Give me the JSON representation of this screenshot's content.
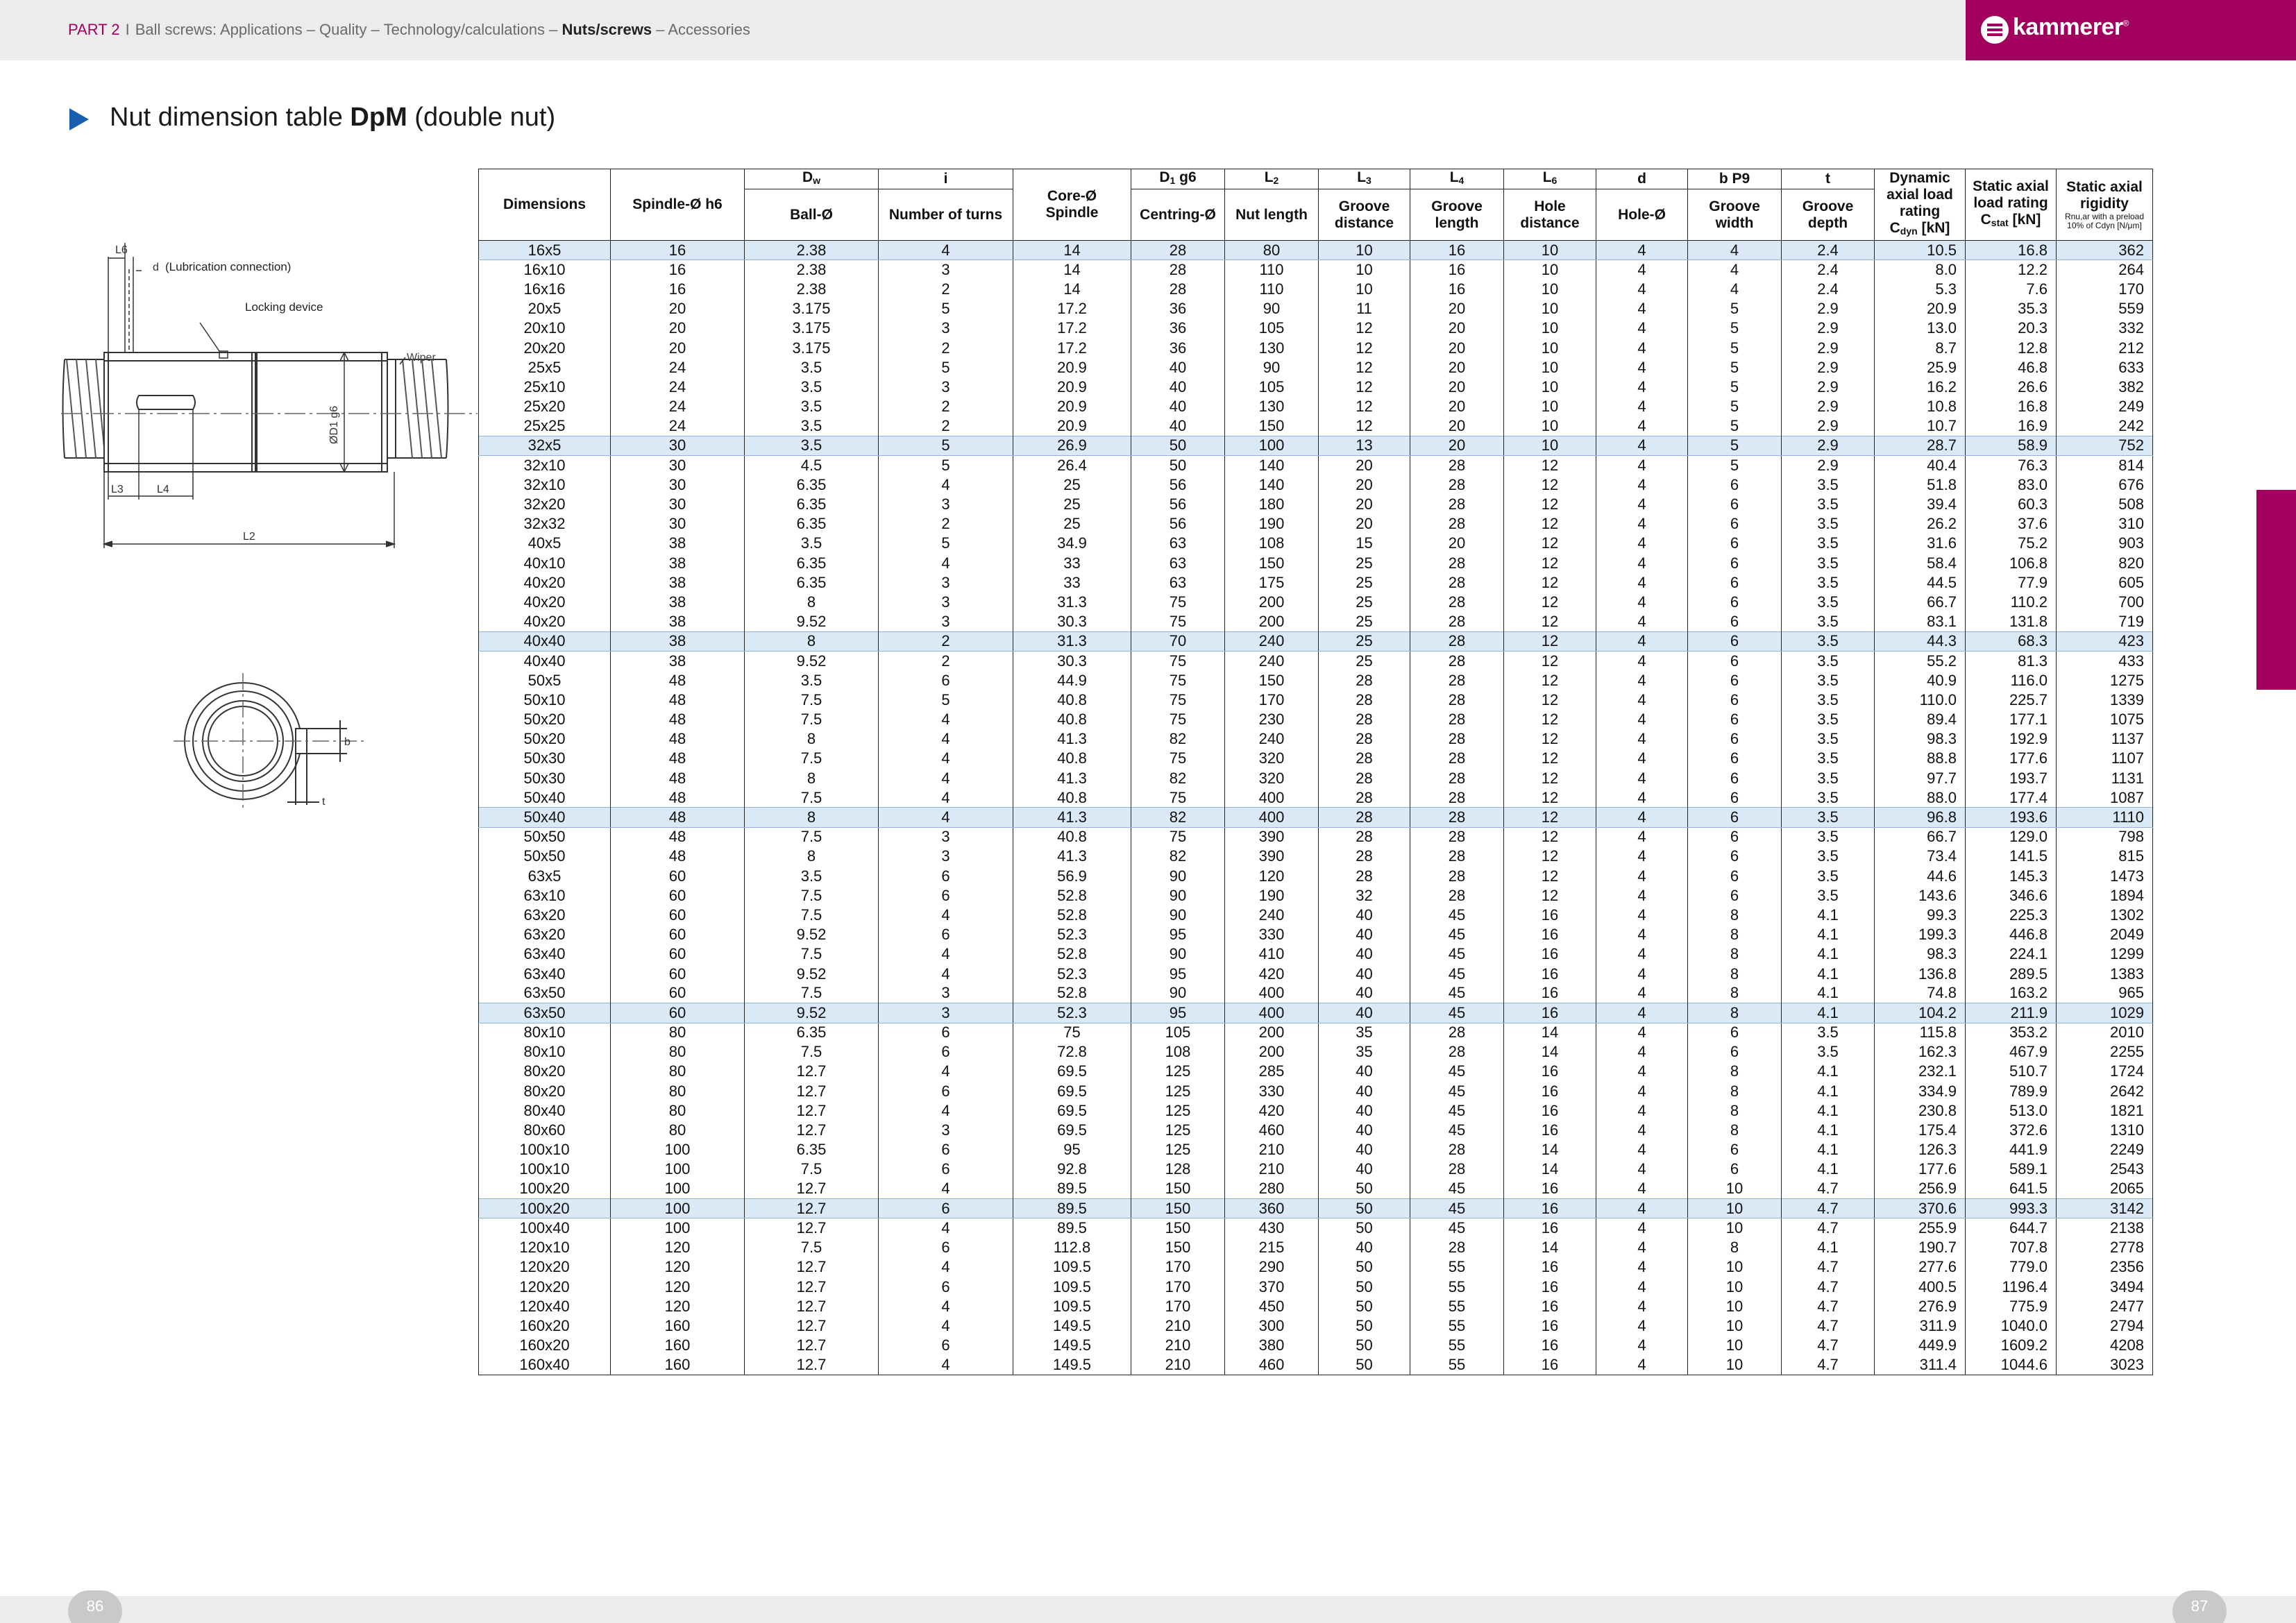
{
  "header": {
    "part": "PART 2",
    "separator": "I",
    "crumbs_before": "Ball screws: Applications – Quality – Technology/calculations –",
    "current": "Nuts/screws",
    "crumbs_after": "– Accessories"
  },
  "brand": {
    "name": "kammerer",
    "reg": "®",
    "color": "#a1005f"
  },
  "title": {
    "prefix": "Nut dimension table",
    "bold": "DpM",
    "suffix": "(double nut)"
  },
  "drawing_labels": {
    "l6": "L6",
    "d": "d",
    "lubrication": "(Lubrication connection)",
    "locking": "Locking device",
    "wiper": "Wiper",
    "d1g6": "ØD1 g6",
    "l3": "L3",
    "l4": "L4",
    "l2": "L2",
    "b": "b",
    "t": "t"
  },
  "table": {
    "header_row1": {
      "dw": "D",
      "dw_sub": "w",
      "i": "i",
      "d1": "D",
      "d1_sub": "1",
      "d1_suffix": " g6",
      "l2": "L",
      "l2_sub": "2",
      "l3": "L",
      "l3_sub": "3",
      "l4": "L",
      "l4_sub": "4",
      "l6": "L",
      "l6_sub": "6",
      "d": "d",
      "bp9": "b P9",
      "t": "t"
    },
    "header_row2": {
      "dimensions": "Dimensions",
      "spindle": "Spindle-Ø h6",
      "ball": "Ball-Ø",
      "turns": "Number of turns",
      "core_1": "Core-Ø",
      "core_2": "Spindle",
      "centring": "Centring-Ø",
      "nut_length": "Nut length",
      "groove_distance_1": "Groove",
      "groove_distance_2": "distance",
      "groove_length_1": "Groove",
      "groove_length_2": "length",
      "hole_distance_1": "Hole",
      "hole_distance_2": "distance",
      "hole": "Hole-Ø",
      "groove_width_1": "Groove",
      "groove_width_2": "width",
      "groove_depth_1": "Groove",
      "groove_depth_2": "depth",
      "dyn_1": "Dynamic",
      "dyn_2": "axial load",
      "dyn_3": "rating",
      "dyn_4": "C",
      "dyn_4_sub": "dyn",
      "dyn_4_unit": " [kN]",
      "stat_1": "Static axial",
      "stat_2": "load rating",
      "stat_3": "C",
      "stat_3_sub": "stat",
      "stat_3_unit": " [kN]",
      "rig_1": "Static axial",
      "rig_2": "rigidity",
      "rig_3": "R",
      "rig_3_sub": "nu,ar",
      "rig_3_rest": " with a preload",
      "rig_4": "10% of C",
      "rig_4_sub": "dyn",
      "rig_4_rest": " [N/μm]"
    },
    "rows": [
      [
        "16x5",
        "16",
        "2.38",
        "4",
        "14",
        "28",
        "80",
        "10",
        "16",
        "10",
        "4",
        "4",
        "2.4",
        "10.5",
        "16.8",
        "362"
      ],
      [
        "16x10",
        "16",
        "2.38",
        "3",
        "14",
        "28",
        "110",
        "10",
        "16",
        "10",
        "4",
        "4",
        "2.4",
        "8.0",
        "12.2",
        "264"
      ],
      [
        "16x16",
        "16",
        "2.38",
        "2",
        "14",
        "28",
        "110",
        "10",
        "16",
        "10",
        "4",
        "4",
        "2.4",
        "5.3",
        "7.6",
        "170"
      ],
      [
        "20x5",
        "20",
        "3.175",
        "5",
        "17.2",
        "36",
        "90",
        "11",
        "20",
        "10",
        "4",
        "5",
        "2.9",
        "20.9",
        "35.3",
        "559"
      ],
      [
        "20x10",
        "20",
        "3.175",
        "3",
        "17.2",
        "36",
        "105",
        "12",
        "20",
        "10",
        "4",
        "5",
        "2.9",
        "13.0",
        "20.3",
        "332"
      ],
      [
        "20x20",
        "20",
        "3.175",
        "2",
        "17.2",
        "36",
        "130",
        "12",
        "20",
        "10",
        "4",
        "5",
        "2.9",
        "8.7",
        "12.8",
        "212"
      ],
      [
        "25x5",
        "24",
        "3.5",
        "5",
        "20.9",
        "40",
        "90",
        "12",
        "20",
        "10",
        "4",
        "5",
        "2.9",
        "25.9",
        "46.8",
        "633"
      ],
      [
        "25x10",
        "24",
        "3.5",
        "3",
        "20.9",
        "40",
        "105",
        "12",
        "20",
        "10",
        "4",
        "5",
        "2.9",
        "16.2",
        "26.6",
        "382"
      ],
      [
        "25x20",
        "24",
        "3.5",
        "2",
        "20.9",
        "40",
        "130",
        "12",
        "20",
        "10",
        "4",
        "5",
        "2.9",
        "10.8",
        "16.8",
        "249"
      ],
      [
        "25x25",
        "24",
        "3.5",
        "2",
        "20.9",
        "40",
        "150",
        "12",
        "20",
        "10",
        "4",
        "5",
        "2.9",
        "10.7",
        "16.9",
        "242"
      ],
      [
        "32x5",
        "30",
        "3.5",
        "5",
        "26.9",
        "50",
        "100",
        "13",
        "20",
        "10",
        "4",
        "5",
        "2.9",
        "28.7",
        "58.9",
        "752"
      ],
      [
        "32x10",
        "30",
        "4.5",
        "5",
        "26.4",
        "50",
        "140",
        "20",
        "28",
        "12",
        "4",
        "5",
        "2.9",
        "40.4",
        "76.3",
        "814"
      ],
      [
        "32x10",
        "30",
        "6.35",
        "4",
        "25",
        "56",
        "140",
        "20",
        "28",
        "12",
        "4",
        "6",
        "3.5",
        "51.8",
        "83.0",
        "676"
      ],
      [
        "32x20",
        "30",
        "6.35",
        "3",
        "25",
        "56",
        "180",
        "20",
        "28",
        "12",
        "4",
        "6",
        "3.5",
        "39.4",
        "60.3",
        "508"
      ],
      [
        "32x32",
        "30",
        "6.35",
        "2",
        "25",
        "56",
        "190",
        "20",
        "28",
        "12",
        "4",
        "6",
        "3.5",
        "26.2",
        "37.6",
        "310"
      ],
      [
        "40x5",
        "38",
        "3.5",
        "5",
        "34.9",
        "63",
        "108",
        "15",
        "20",
        "12",
        "4",
        "6",
        "3.5",
        "31.6",
        "75.2",
        "903"
      ],
      [
        "40x10",
        "38",
        "6.35",
        "4",
        "33",
        "63",
        "150",
        "25",
        "28",
        "12",
        "4",
        "6",
        "3.5",
        "58.4",
        "106.8",
        "820"
      ],
      [
        "40x20",
        "38",
        "6.35",
        "3",
        "33",
        "63",
        "175",
        "25",
        "28",
        "12",
        "4",
        "6",
        "3.5",
        "44.5",
        "77.9",
        "605"
      ],
      [
        "40x20",
        "38",
        "8",
        "3",
        "31.3",
        "75",
        "200",
        "25",
        "28",
        "12",
        "4",
        "6",
        "3.5",
        "66.7",
        "110.2",
        "700"
      ],
      [
        "40x20",
        "38",
        "9.52",
        "3",
        "30.3",
        "75",
        "200",
        "25",
        "28",
        "12",
        "4",
        "6",
        "3.5",
        "83.1",
        "131.8",
        "719"
      ],
      [
        "40x40",
        "38",
        "8",
        "2",
        "31.3",
        "70",
        "240",
        "25",
        "28",
        "12",
        "4",
        "6",
        "3.5",
        "44.3",
        "68.3",
        "423"
      ],
      [
        "40x40",
        "38",
        "9.52",
        "2",
        "30.3",
        "75",
        "240",
        "25",
        "28",
        "12",
        "4",
        "6",
        "3.5",
        "55.2",
        "81.3",
        "433"
      ],
      [
        "50x5",
        "48",
        "3.5",
        "6",
        "44.9",
        "75",
        "150",
        "28",
        "28",
        "12",
        "4",
        "6",
        "3.5",
        "40.9",
        "116.0",
        "1275"
      ],
      [
        "50x10",
        "48",
        "7.5",
        "5",
        "40.8",
        "75",
        "170",
        "28",
        "28",
        "12",
        "4",
        "6",
        "3.5",
        "110.0",
        "225.7",
        "1339"
      ],
      [
        "50x20",
        "48",
        "7.5",
        "4",
        "40.8",
        "75",
        "230",
        "28",
        "28",
        "12",
        "4",
        "6",
        "3.5",
        "89.4",
        "177.1",
        "1075"
      ],
      [
        "50x20",
        "48",
        "8",
        "4",
        "41.3",
        "82",
        "240",
        "28",
        "28",
        "12",
        "4",
        "6",
        "3.5",
        "98.3",
        "192.9",
        "1137"
      ],
      [
        "50x30",
        "48",
        "7.5",
        "4",
        "40.8",
        "75",
        "320",
        "28",
        "28",
        "12",
        "4",
        "6",
        "3.5",
        "88.8",
        "177.6",
        "1107"
      ],
      [
        "50x30",
        "48",
        "8",
        "4",
        "41.3",
        "82",
        "320",
        "28",
        "28",
        "12",
        "4",
        "6",
        "3.5",
        "97.7",
        "193.7",
        "1131"
      ],
      [
        "50x40",
        "48",
        "7.5",
        "4",
        "40.8",
        "75",
        "400",
        "28",
        "28",
        "12",
        "4",
        "6",
        "3.5",
        "88.0",
        "177.4",
        "1087"
      ],
      [
        "50x40",
        "48",
        "8",
        "4",
        "41.3",
        "82",
        "400",
        "28",
        "28",
        "12",
        "4",
        "6",
        "3.5",
        "96.8",
        "193.6",
        "1110"
      ],
      [
        "50x50",
        "48",
        "7.5",
        "3",
        "40.8",
        "75",
        "390",
        "28",
        "28",
        "12",
        "4",
        "6",
        "3.5",
        "66.7",
        "129.0",
        "798"
      ],
      [
        "50x50",
        "48",
        "8",
        "3",
        "41.3",
        "82",
        "390",
        "28",
        "28",
        "12",
        "4",
        "6",
        "3.5",
        "73.4",
        "141.5",
        "815"
      ],
      [
        "63x5",
        "60",
        "3.5",
        "6",
        "56.9",
        "90",
        "120",
        "28",
        "28",
        "12",
        "4",
        "6",
        "3.5",
        "44.6",
        "145.3",
        "1473"
      ],
      [
        "63x10",
        "60",
        "7.5",
        "6",
        "52.8",
        "90",
        "190",
        "32",
        "28",
        "12",
        "4",
        "6",
        "3.5",
        "143.6",
        "346.6",
        "1894"
      ],
      [
        "63x20",
        "60",
        "7.5",
        "4",
        "52.8",
        "90",
        "240",
        "40",
        "45",
        "16",
        "4",
        "8",
        "4.1",
        "99.3",
        "225.3",
        "1302"
      ],
      [
        "63x20",
        "60",
        "9.52",
        "6",
        "52.3",
        "95",
        "330",
        "40",
        "45",
        "16",
        "4",
        "8",
        "4.1",
        "199.3",
        "446.8",
        "2049"
      ],
      [
        "63x40",
        "60",
        "7.5",
        "4",
        "52.8",
        "90",
        "410",
        "40",
        "45",
        "16",
        "4",
        "8",
        "4.1",
        "98.3",
        "224.1",
        "1299"
      ],
      [
        "63x40",
        "60",
        "9.52",
        "4",
        "52.3",
        "95",
        "420",
        "40",
        "45",
        "16",
        "4",
        "8",
        "4.1",
        "136.8",
        "289.5",
        "1383"
      ],
      [
        "63x50",
        "60",
        "7.5",
        "3",
        "52.8",
        "90",
        "400",
        "40",
        "45",
        "16",
        "4",
        "8",
        "4.1",
        "74.8",
        "163.2",
        "965"
      ],
      [
        "63x50",
        "60",
        "9.52",
        "3",
        "52.3",
        "95",
        "400",
        "40",
        "45",
        "16",
        "4",
        "8",
        "4.1",
        "104.2",
        "211.9",
        "1029"
      ],
      [
        "80x10",
        "80",
        "6.35",
        "6",
        "75",
        "105",
        "200",
        "35",
        "28",
        "14",
        "4",
        "6",
        "3.5",
        "115.8",
        "353.2",
        "2010"
      ],
      [
        "80x10",
        "80",
        "7.5",
        "6",
        "72.8",
        "108",
        "200",
        "35",
        "28",
        "14",
        "4",
        "6",
        "3.5",
        "162.3",
        "467.9",
        "2255"
      ],
      [
        "80x20",
        "80",
        "12.7",
        "4",
        "69.5",
        "125",
        "285",
        "40",
        "45",
        "16",
        "4",
        "8",
        "4.1",
        "232.1",
        "510.7",
        "1724"
      ],
      [
        "80x20",
        "80",
        "12.7",
        "6",
        "69.5",
        "125",
        "330",
        "40",
        "45",
        "16",
        "4",
        "8",
        "4.1",
        "334.9",
        "789.9",
        "2642"
      ],
      [
        "80x40",
        "80",
        "12.7",
        "4",
        "69.5",
        "125",
        "420",
        "40",
        "45",
        "16",
        "4",
        "8",
        "4.1",
        "230.8",
        "513.0",
        "1821"
      ],
      [
        "80x60",
        "80",
        "12.7",
        "3",
        "69.5",
        "125",
        "460",
        "40",
        "45",
        "16",
        "4",
        "8",
        "4.1",
        "175.4",
        "372.6",
        "1310"
      ],
      [
        "100x10",
        "100",
        "6.35",
        "6",
        "95",
        "125",
        "210",
        "40",
        "28",
        "14",
        "4",
        "6",
        "4.1",
        "126.3",
        "441.9",
        "2249"
      ],
      [
        "100x10",
        "100",
        "7.5",
        "6",
        "92.8",
        "128",
        "210",
        "40",
        "28",
        "14",
        "4",
        "6",
        "4.1",
        "177.6",
        "589.1",
        "2543"
      ],
      [
        "100x20",
        "100",
        "12.7",
        "4",
        "89.5",
        "150",
        "280",
        "50",
        "45",
        "16",
        "4",
        "10",
        "4.7",
        "256.9",
        "641.5",
        "2065"
      ],
      [
        "100x20",
        "100",
        "12.7",
        "6",
        "89.5",
        "150",
        "360",
        "50",
        "45",
        "16",
        "4",
        "10",
        "4.7",
        "370.6",
        "993.3",
        "3142"
      ],
      [
        "100x40",
        "100",
        "12.7",
        "4",
        "89.5",
        "150",
        "430",
        "50",
        "45",
        "16",
        "4",
        "10",
        "4.7",
        "255.9",
        "644.7",
        "2138"
      ],
      [
        "120x10",
        "120",
        "7.5",
        "6",
        "112.8",
        "150",
        "215",
        "40",
        "28",
        "14",
        "4",
        "8",
        "4.1",
        "190.7",
        "707.8",
        "2778"
      ],
      [
        "120x20",
        "120",
        "12.7",
        "4",
        "109.5",
        "170",
        "290",
        "50",
        "55",
        "16",
        "4",
        "10",
        "4.7",
        "277.6",
        "779.0",
        "2356"
      ],
      [
        "120x20",
        "120",
        "12.7",
        "6",
        "109.5",
        "170",
        "370",
        "50",
        "55",
        "16",
        "4",
        "10",
        "4.7",
        "400.5",
        "1196.4",
        "3494"
      ],
      [
        "120x40",
        "120",
        "12.7",
        "4",
        "109.5",
        "170",
        "450",
        "50",
        "55",
        "16",
        "4",
        "10",
        "4.7",
        "276.9",
        "775.9",
        "2477"
      ],
      [
        "160x20",
        "160",
        "12.7",
        "4",
        "149.5",
        "210",
        "300",
        "50",
        "55",
        "16",
        "4",
        "10",
        "4.7",
        "311.9",
        "1040.0",
        "2794"
      ],
      [
        "160x20",
        "160",
        "12.7",
        "6",
        "149.5",
        "210",
        "380",
        "50",
        "55",
        "16",
        "4",
        "10",
        "4.7",
        "449.9",
        "1609.2",
        "4208"
      ],
      [
        "160x40",
        "160",
        "12.7",
        "4",
        "149.5",
        "210",
        "460",
        "50",
        "55",
        "16",
        "4",
        "10",
        "4.7",
        "311.4",
        "1044.6",
        "3023"
      ]
    ],
    "highlighted_rows": [
      0,
      10,
      20,
      29,
      39,
      49
    ],
    "highlight_color": "#dbe9f6"
  },
  "footer": {
    "page_left": "86",
    "page_right": "87"
  }
}
